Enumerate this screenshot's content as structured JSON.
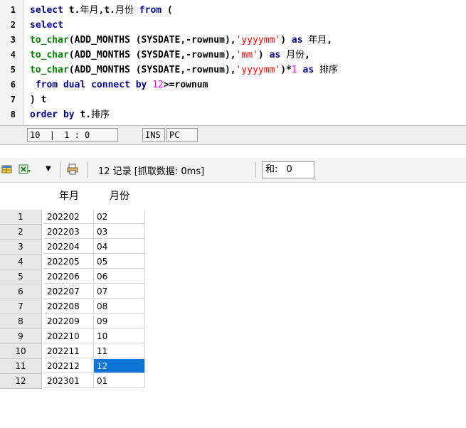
{
  "editor": {
    "lines": [
      {
        "n": "1",
        "parts": [
          [
            "kw",
            "select "
          ],
          [
            "plain",
            "t."
          ],
          [
            "cn",
            "年月"
          ],
          [
            "plain",
            ",t."
          ],
          [
            "cn",
            "月份"
          ],
          [
            "kw",
            " from"
          ],
          [
            "plain",
            " ("
          ]
        ]
      },
      {
        "n": "2",
        "parts": [
          [
            "kw",
            "select"
          ]
        ]
      },
      {
        "n": "3",
        "parts": [
          [
            "fn",
            "to_char"
          ],
          [
            "plain",
            "(ADD_MONTHS (SYSDATE,-rownum),"
          ],
          [
            "str",
            "'yyyymm'"
          ],
          [
            "plain",
            ") "
          ],
          [
            "kw",
            "as "
          ],
          [
            "cn",
            "年月"
          ],
          [
            "plain",
            ","
          ]
        ]
      },
      {
        "n": "4",
        "parts": [
          [
            "fn",
            "to_char"
          ],
          [
            "plain",
            "(ADD_MONTHS (SYSDATE,-rownum),"
          ],
          [
            "str",
            "'mm'"
          ],
          [
            "plain",
            ") "
          ],
          [
            "kw",
            "as "
          ],
          [
            "cn",
            "月份"
          ],
          [
            "plain",
            ","
          ]
        ]
      },
      {
        "n": "5",
        "parts": [
          [
            "fn",
            "to_char"
          ],
          [
            "plain",
            "(ADD_MONTHS (SYSDATE,-rownum),"
          ],
          [
            "str",
            "'yyyymm'"
          ],
          [
            "plain",
            ")*"
          ],
          [
            "num",
            "1"
          ],
          [
            "kw",
            " as "
          ],
          [
            "cn",
            "排序"
          ]
        ]
      },
      {
        "n": "6",
        "parts": [
          [
            "kw",
            " from dual connect by "
          ],
          [
            "num",
            "12"
          ],
          [
            "plain",
            ">=rownum"
          ]
        ]
      },
      {
        "n": "7",
        "parts": [
          [
            "plain",
            ") t"
          ]
        ]
      },
      {
        "n": "8",
        "parts": [
          [
            "kw",
            "order by "
          ],
          [
            "plain",
            "t."
          ],
          [
            "cn",
            "排序"
          ]
        ]
      }
    ]
  },
  "status": {
    "line": "10",
    "col": "1 : 0",
    "mode": "INS",
    "encoding": "PC"
  },
  "toolbar": {
    "record_info": "12 记录 [抓取数据: 0ms]",
    "sum_label": "和:",
    "sum_value": "0"
  },
  "grid": {
    "columns": [
      "年月",
      "月份"
    ],
    "rows": [
      [
        "1",
        "202202",
        "02"
      ],
      [
        "2",
        "202203",
        "03"
      ],
      [
        "3",
        "202204",
        "04"
      ],
      [
        "4",
        "202205",
        "05"
      ],
      [
        "5",
        "202206",
        "06"
      ],
      [
        "6",
        "202207",
        "07"
      ],
      [
        "7",
        "202208",
        "08"
      ],
      [
        "8",
        "202209",
        "09"
      ],
      [
        "9",
        "202210",
        "10"
      ],
      [
        "10",
        "202211",
        "11"
      ],
      [
        "11",
        "202212",
        "12"
      ],
      [
        "12",
        "202301",
        "01"
      ]
    ],
    "selected": {
      "row": 10,
      "col": 1
    },
    "selection_color": "#0a74d9"
  }
}
